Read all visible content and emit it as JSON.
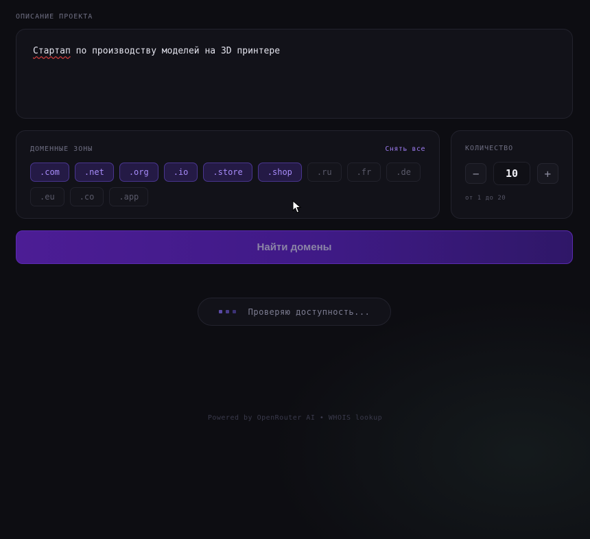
{
  "description": {
    "label": "ОПИСАНИЕ ПРОЕКТА",
    "first_word": "Стартап",
    "rest_text": " по производству моделей на 3D принтере"
  },
  "zones": {
    "title": "ДОМЕННЫЕ ЗОНЫ",
    "clear_label": "Снять все",
    "items": [
      {
        "label": ".com",
        "selected": true
      },
      {
        "label": ".net",
        "selected": true
      },
      {
        "label": ".org",
        "selected": true
      },
      {
        "label": ".io",
        "selected": true
      },
      {
        "label": ".store",
        "selected": true
      },
      {
        "label": ".shop",
        "selected": true
      },
      {
        "label": ".ru",
        "selected": false
      },
      {
        "label": ".fr",
        "selected": false
      },
      {
        "label": ".de",
        "selected": false
      },
      {
        "label": ".eu",
        "selected": false
      },
      {
        "label": ".co",
        "selected": false
      },
      {
        "label": ".app",
        "selected": false
      }
    ]
  },
  "quantity": {
    "title": "КОЛИЧЕСТВО",
    "minus": "−",
    "value": "10",
    "plus": "+",
    "hint": "от 1 до 20"
  },
  "submit_label": "Найти домены",
  "status": {
    "text": "Проверяю доступность..."
  },
  "footer": {
    "text": "Powered by OpenRouter AI • WHOIS lookup"
  },
  "colors": {
    "accent": "#a78bfa",
    "button_gradient_start": "#4c1d95",
    "background": "#0d0d12"
  }
}
